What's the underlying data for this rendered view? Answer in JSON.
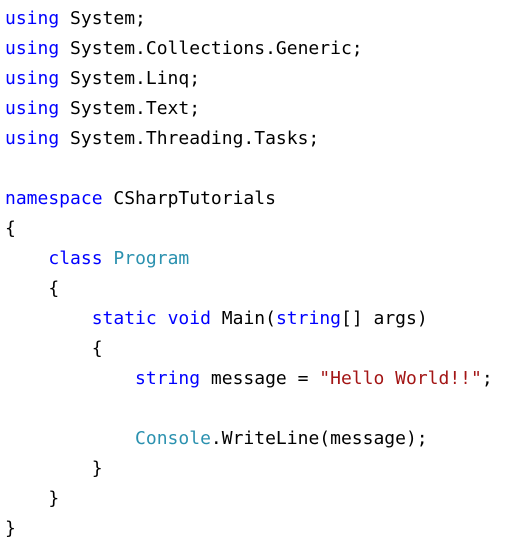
{
  "editor": {
    "language": "C#",
    "colors": {
      "background": "#ffffff",
      "keyword": "#0000ff",
      "type": "#2b91af",
      "string": "#a31515",
      "plain": "#000000"
    },
    "lines": [
      [
        {
          "text": "using",
          "kind": "keyword"
        },
        {
          "text": " System;",
          "kind": "plain"
        }
      ],
      [
        {
          "text": "using",
          "kind": "keyword"
        },
        {
          "text": " System.Collections.Generic;",
          "kind": "plain"
        }
      ],
      [
        {
          "text": "using",
          "kind": "keyword"
        },
        {
          "text": " System.Linq;",
          "kind": "plain"
        }
      ],
      [
        {
          "text": "using",
          "kind": "keyword"
        },
        {
          "text": " System.Text;",
          "kind": "plain"
        }
      ],
      [
        {
          "text": "using",
          "kind": "keyword"
        },
        {
          "text": " System.Threading.Tasks;",
          "kind": "plain"
        }
      ],
      [],
      [
        {
          "text": "namespace",
          "kind": "keyword"
        },
        {
          "text": " CSharpTutorials",
          "kind": "plain"
        }
      ],
      [
        {
          "text": "{",
          "kind": "plain"
        }
      ],
      [
        {
          "text": "    ",
          "kind": "plain"
        },
        {
          "text": "class",
          "kind": "keyword"
        },
        {
          "text": " ",
          "kind": "plain"
        },
        {
          "text": "Program",
          "kind": "type"
        }
      ],
      [
        {
          "text": "    {",
          "kind": "plain"
        }
      ],
      [
        {
          "text": "        ",
          "kind": "plain"
        },
        {
          "text": "static",
          "kind": "keyword"
        },
        {
          "text": " ",
          "kind": "plain"
        },
        {
          "text": "void",
          "kind": "keyword"
        },
        {
          "text": " Main(",
          "kind": "plain"
        },
        {
          "text": "string",
          "kind": "keyword"
        },
        {
          "text": "[] args)",
          "kind": "plain"
        }
      ],
      [
        {
          "text": "        {",
          "kind": "plain"
        }
      ],
      [
        {
          "text": "            ",
          "kind": "plain"
        },
        {
          "text": "string",
          "kind": "keyword"
        },
        {
          "text": " message = ",
          "kind": "plain"
        },
        {
          "text": "\"Hello World!!\"",
          "kind": "string"
        },
        {
          "text": ";",
          "kind": "plain"
        }
      ],
      [],
      [
        {
          "text": "            ",
          "kind": "plain"
        },
        {
          "text": "Console",
          "kind": "type"
        },
        {
          "text": ".WriteLine(message);",
          "kind": "plain"
        }
      ],
      [
        {
          "text": "        }",
          "kind": "plain"
        }
      ],
      [
        {
          "text": "    }",
          "kind": "plain"
        }
      ],
      [
        {
          "text": "}",
          "kind": "plain"
        }
      ]
    ]
  }
}
